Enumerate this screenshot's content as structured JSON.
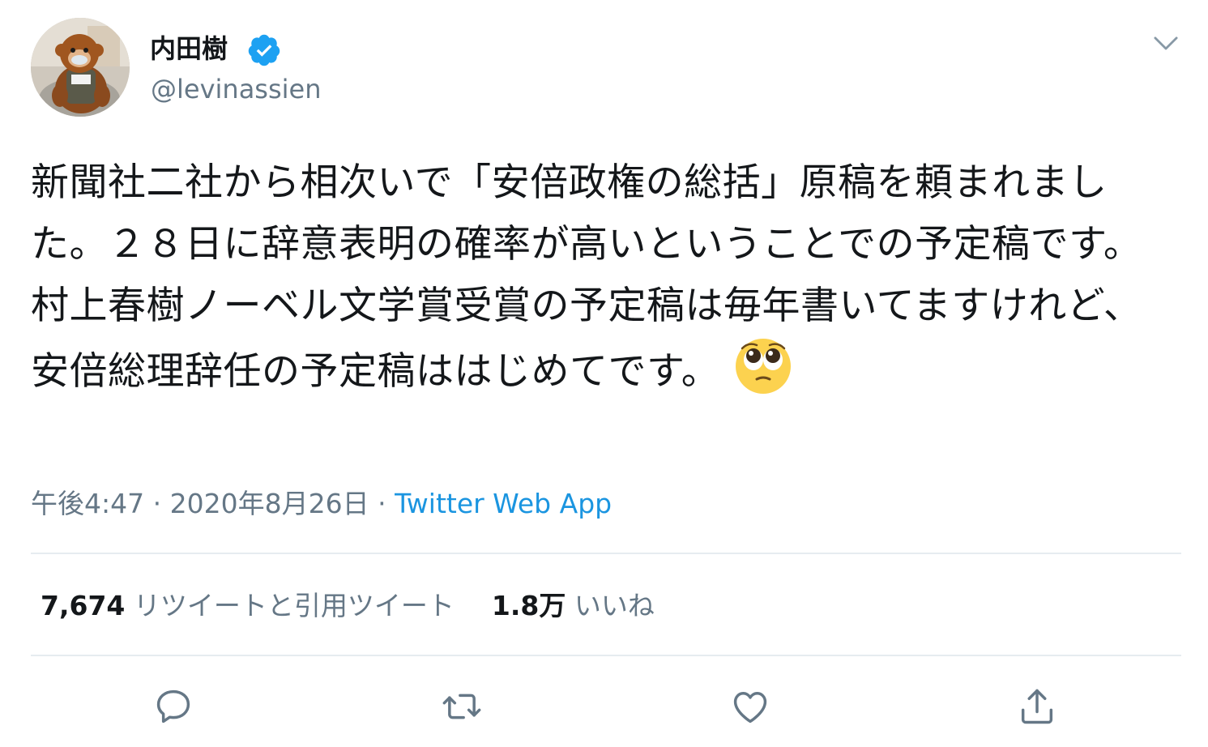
{
  "user": {
    "display_name": "内田樹",
    "handle": "@levinassien",
    "verified": true
  },
  "tweet": {
    "text": "新聞社二社から相次いで「安倍政権の総括」原稿を頼まれました。２８日に辞意表明の確率が高いということでの予定稿です。村上春樹ノーベル文学賞受賞の予定稿は毎年書いてますけれど、安倍総理辞任の予定稿ははじめてです。",
    "emoji": "pleading-face-emoji",
    "time": "午後4:47",
    "separator": "·",
    "date": "2020年8月26日",
    "source": "Twitter Web App"
  },
  "stats": {
    "retweets_count": "7,674",
    "retweets_label": "リツイートと引用ツイート",
    "likes_count": "1.8万",
    "likes_label": "いいね"
  },
  "actions": {
    "reply_icon": "reply-icon",
    "retweet_icon": "retweet-icon",
    "like_icon": "like-icon",
    "share_icon": "share-icon"
  },
  "colors": {
    "text": "#14171a",
    "secondary": "#657786",
    "link": "#1b95e0",
    "divider": "#e6ecf0",
    "verified": "#1da1f2"
  }
}
